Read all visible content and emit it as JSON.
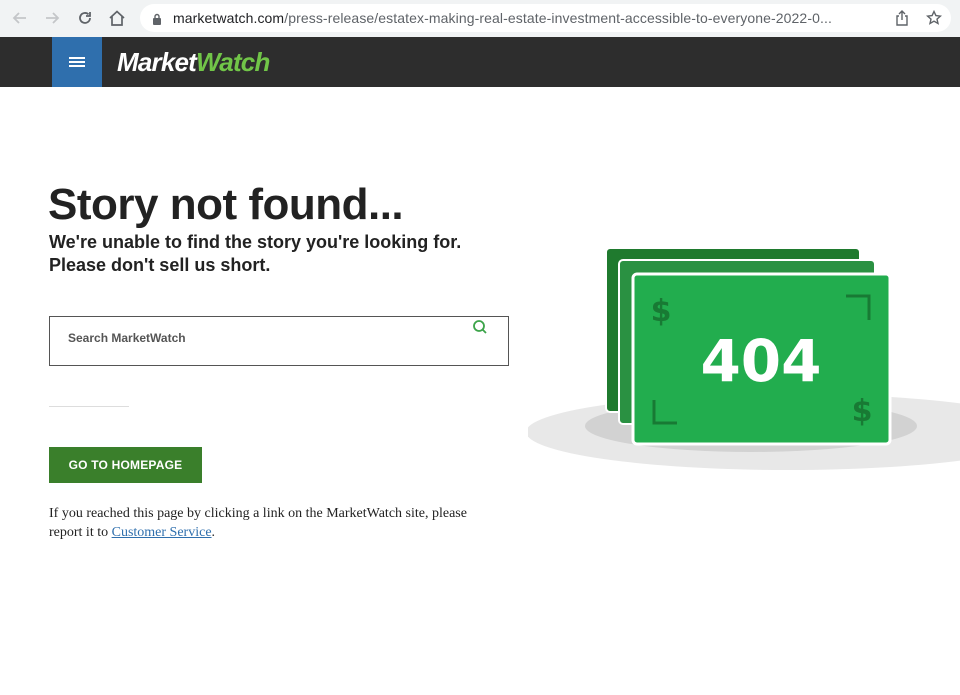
{
  "browser": {
    "url_host": "marketwatch.com",
    "url_path": "/press-release/estatex-making-real-estate-investment-accessible-to-everyone-2022-0..."
  },
  "site": {
    "logo_part1": "Market",
    "logo_part2": "Watch",
    "accent_color": "#71c548"
  },
  "error": {
    "title": "Story not found...",
    "subtitle_line1": "We're unable to find the story you're looking for.",
    "subtitle_line2": "Please don't sell us short.",
    "search_placeholder": "Search MarketWatch",
    "homepage_button": "GO TO HOMEPAGE",
    "note_text": "If you reached this page by clicking a link on the MarketWatch site, please report it to ",
    "note_link": "Customer Service",
    "note_end": "."
  },
  "illustration": {
    "code": "404",
    "currency_symbol": "$"
  }
}
